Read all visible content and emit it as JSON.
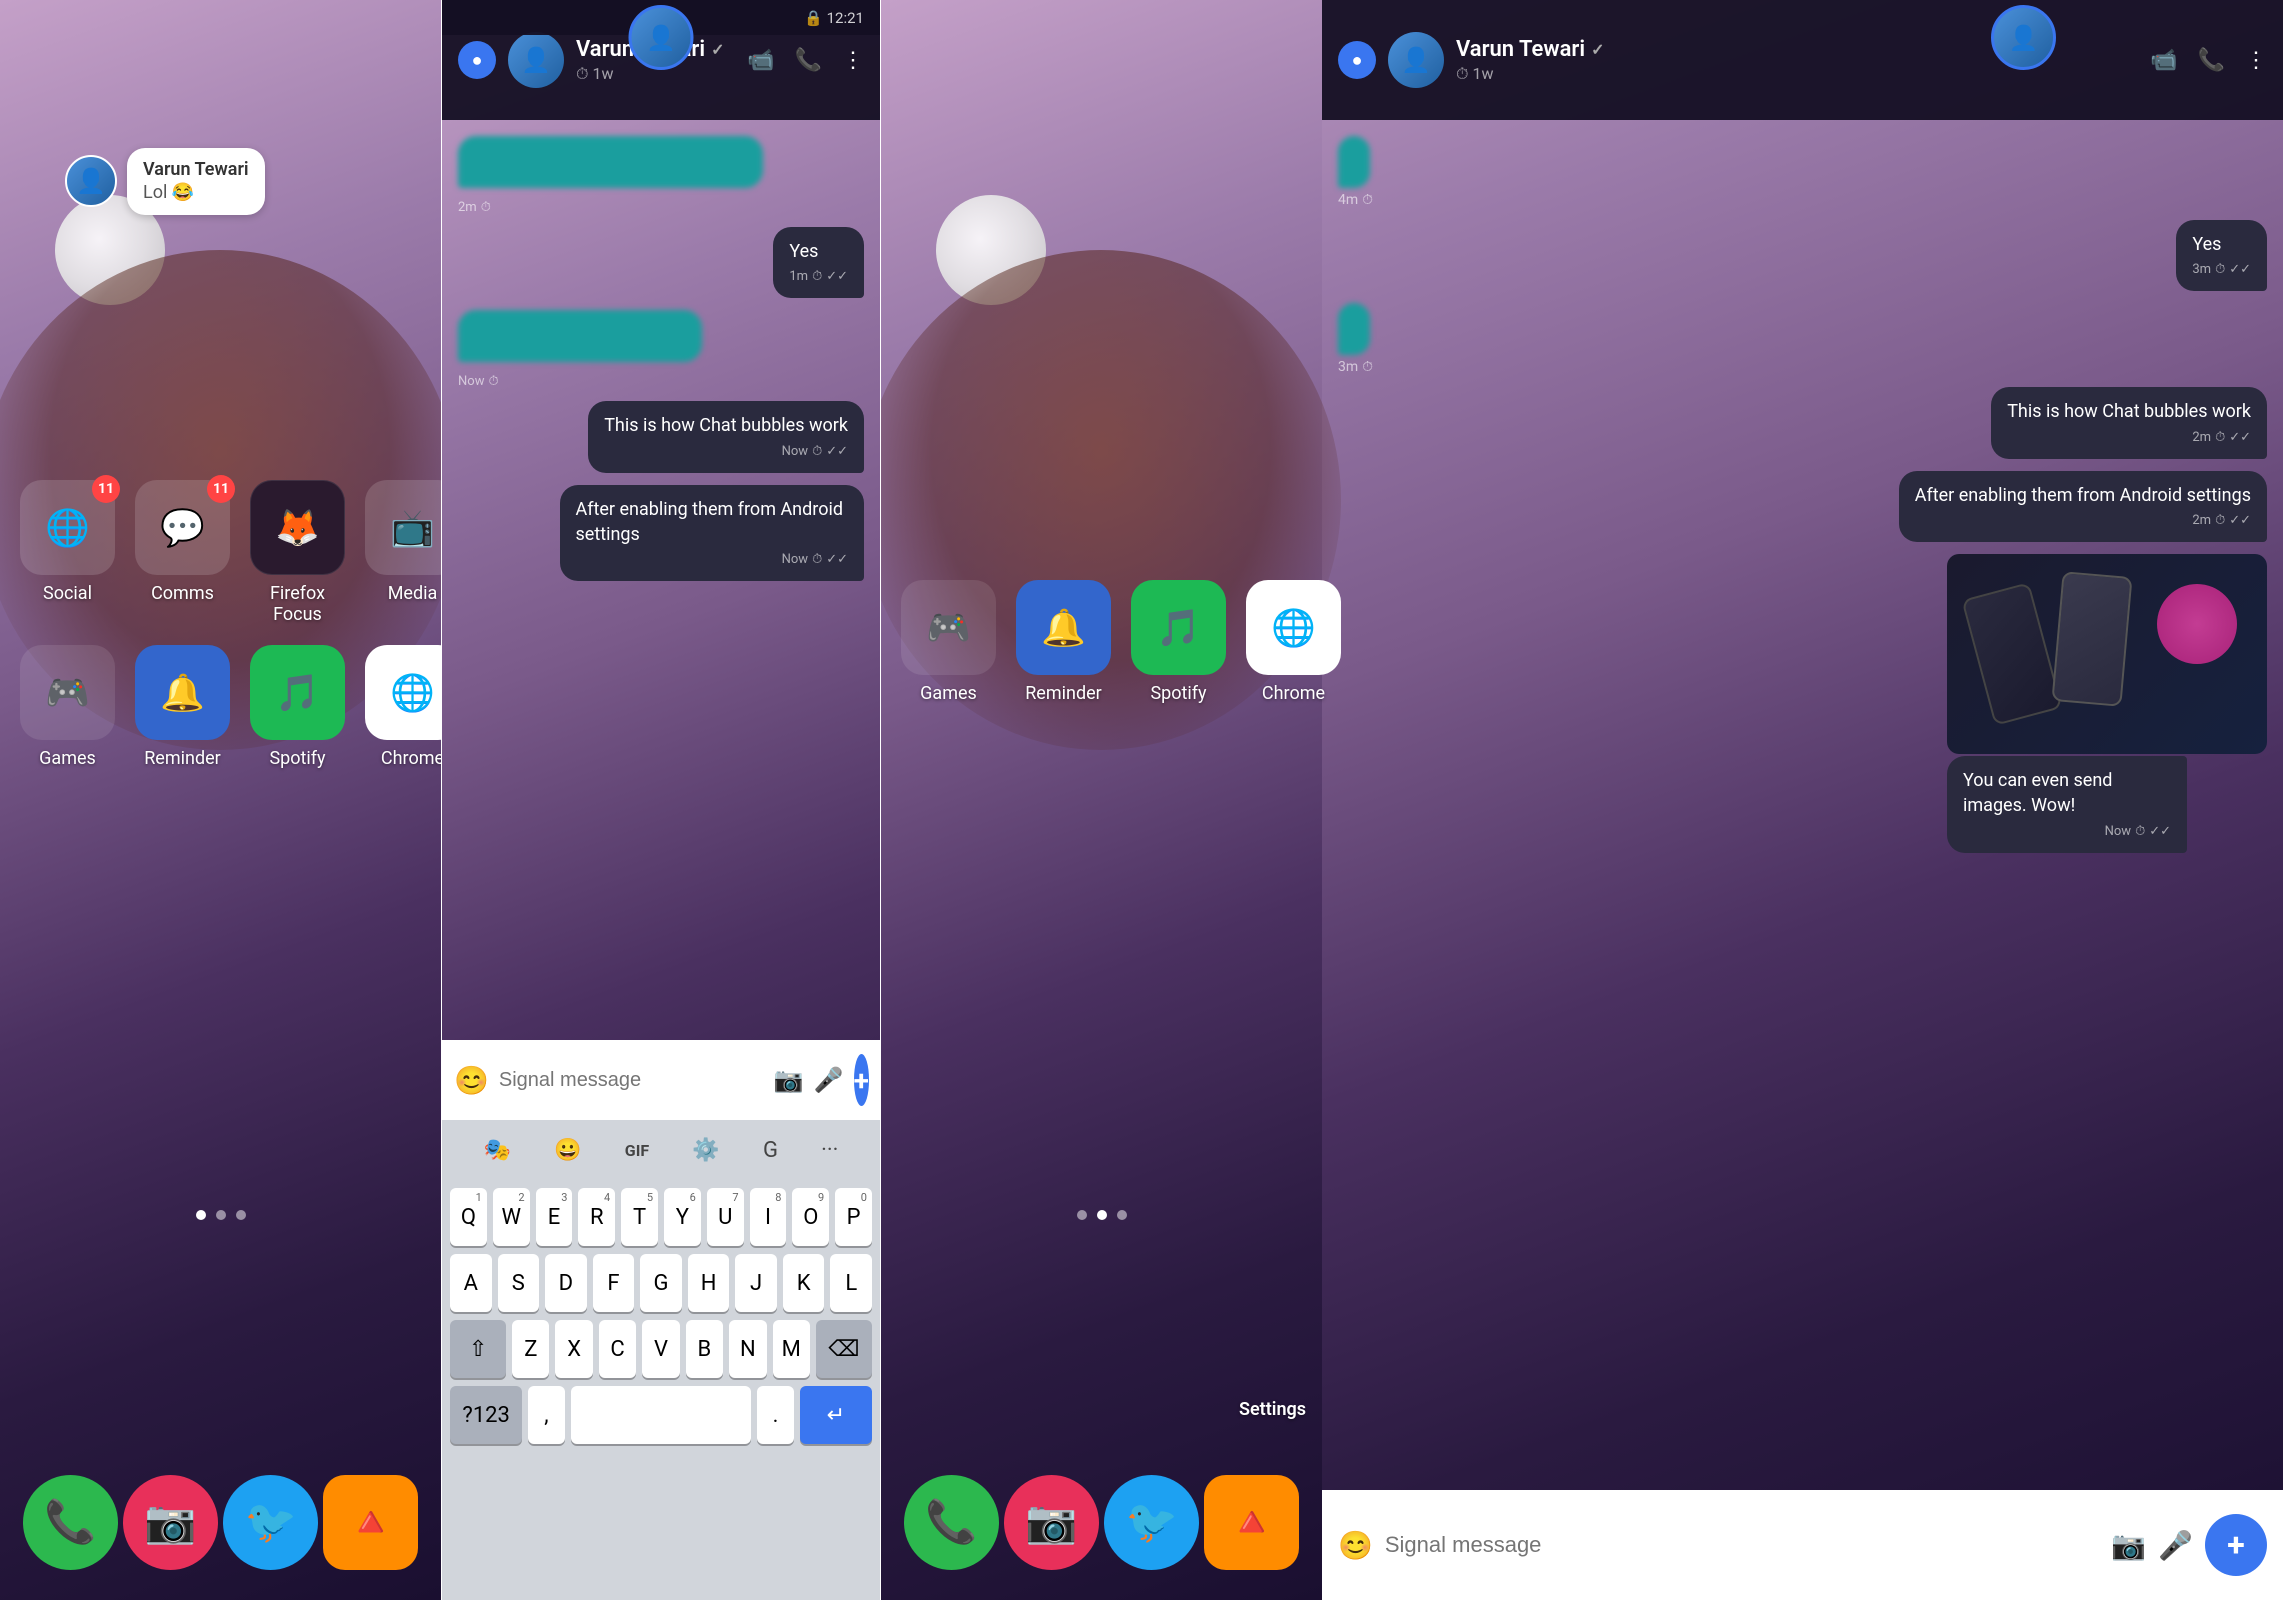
{
  "left_panel": {
    "notification": {
      "sender": "Varun Tewari",
      "message": "Lol 😂"
    },
    "apps_row1": [
      {
        "label": "Social",
        "badge": "11",
        "emoji": "🌐"
      },
      {
        "label": "Comms",
        "badge": "11",
        "emoji": "💬"
      },
      {
        "label": "Firefox Focus",
        "badge": null,
        "emoji": "🦊"
      },
      {
        "label": "Media",
        "badge": null,
        "emoji": "📺"
      }
    ],
    "apps_row2": [
      {
        "label": "Games",
        "badge": null,
        "emoji": "🎮"
      },
      {
        "label": "Reminder",
        "badge": null,
        "emoji": "🔔"
      },
      {
        "label": "Spotify",
        "badge": null,
        "emoji": "🎵"
      },
      {
        "label": "Chrome",
        "badge": null,
        "emoji": "🌐"
      }
    ],
    "dock": [
      {
        "label": "Phone",
        "emoji": "📞",
        "bg": "#2cb84e"
      },
      {
        "label": "Camera",
        "emoji": "📷",
        "bg": "#e8305a"
      },
      {
        "label": "Twitter",
        "emoji": "🐦",
        "bg": "#1da1f2"
      },
      {
        "label": "Navigate",
        "emoji": "🔺",
        "bg": "#ff8c00"
      }
    ]
  },
  "middle_panel": {
    "header": {
      "contact": "Varun Tewari",
      "status": "1w",
      "verified_icon": "✓"
    },
    "messages": [
      {
        "type": "incoming",
        "text": "",
        "time": "2m",
        "blurred": true
      },
      {
        "type": "outgoing",
        "text": "Yes",
        "time": "1m"
      },
      {
        "type": "incoming",
        "text": "",
        "time": "Now",
        "blurred": true
      },
      {
        "type": "outgoing",
        "text": "This is how Chat bubbles work",
        "time": "Now"
      },
      {
        "type": "outgoing",
        "text": "After enabling them from Android settings",
        "time": "Now"
      }
    ],
    "input": {
      "placeholder": "Signal message"
    },
    "keyboard_rows": [
      [
        "Q",
        "W",
        "E",
        "R",
        "T",
        "Y",
        "U",
        "I",
        "O",
        "P"
      ],
      [
        "A",
        "S",
        "D",
        "F",
        "G",
        "H",
        "J",
        "K",
        "L"
      ],
      [
        "Z",
        "X",
        "C",
        "V",
        "B",
        "N",
        "M"
      ],
      [
        "?123",
        ",",
        "SPACE",
        ".",
        "ENTER"
      ]
    ],
    "keyboard_nums": [
      "1",
      "2",
      "3",
      "4",
      "5",
      "6",
      "7",
      "8",
      "9",
      "0"
    ]
  },
  "right_panel": {
    "header": {
      "contact": "Varun Tewari",
      "status": "1w",
      "verified_icon": "✓"
    },
    "messages": [
      {
        "type": "incoming",
        "text": "",
        "time": "4m",
        "blurred": true
      },
      {
        "type": "outgoing",
        "text": "Yes",
        "time": "3m"
      },
      {
        "type": "incoming",
        "text": "",
        "time": "3m",
        "blurred": true
      },
      {
        "type": "outgoing",
        "text": "This is how Chat bubbles work",
        "time": "2m"
      },
      {
        "type": "outgoing",
        "text": "After enabling them from Android settings",
        "time": "2m"
      },
      {
        "type": "outgoing",
        "text": "You can even send images. Wow!",
        "time": "Now",
        "has_image": true
      }
    ],
    "input": {
      "placeholder": "Signal message"
    },
    "home_apps_row1": [
      {
        "label": "Games",
        "emoji": "🎮"
      },
      {
        "label": "Reminder",
        "emoji": "🔔"
      },
      {
        "label": "Spotify",
        "emoji": "🎵"
      },
      {
        "label": "Chrome",
        "emoji": "🌐"
      }
    ],
    "dock": [
      {
        "label": "Phone",
        "emoji": "📞",
        "bg": "#2cb84e"
      },
      {
        "label": "Camera",
        "emoji": "📷",
        "bg": "#e8305a"
      },
      {
        "label": "Twitter",
        "emoji": "🐦",
        "bg": "#1da1f2"
      },
      {
        "label": "Navigate",
        "emoji": "🔺",
        "bg": "#ff8c00"
      }
    ],
    "settings_label": "Settings"
  },
  "icons": {
    "video_call": "📹",
    "phone_call": "📞",
    "more": "⋮",
    "emoji": "😊",
    "camera": "📷",
    "mic": "🎤",
    "plus": "+",
    "shift": "⇧",
    "backspace": "⌫",
    "enter": "↵",
    "signal_logo": "●"
  }
}
